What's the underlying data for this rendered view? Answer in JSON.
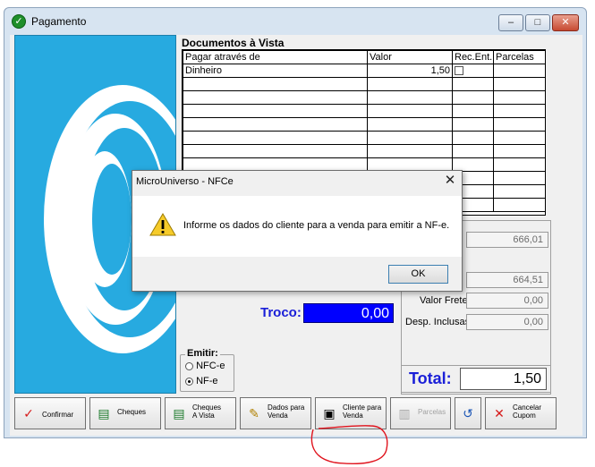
{
  "window": {
    "title": "Pagamento",
    "min_label": "–",
    "max_label": "□",
    "close_label": "✕"
  },
  "documentos": {
    "title": "Documentos à Vista",
    "columns": [
      "Pagar através de",
      "Valor",
      "Rec.Ent.",
      "Parcelas"
    ],
    "rows": [
      {
        "pagar": "Dinheiro",
        "valor": "1,50",
        "rec": "",
        "parcelas": ""
      }
    ],
    "empty_rows": 10
  },
  "totals": {
    "field1_value": "666,01",
    "field2_value": "664,51",
    "frete_label": "Valor Frete:",
    "frete_value": "0,00",
    "desp_label": "Desp. Inclusas:",
    "desp_value": "0,00"
  },
  "troco": {
    "label": "Troco:",
    "value": "0,00"
  },
  "emitir": {
    "label": "Emitir:",
    "options": [
      {
        "label": "NFC-e",
        "selected": false
      },
      {
        "label": "NF-e",
        "selected": true
      }
    ]
  },
  "total": {
    "label": "Total:",
    "value": "1,50"
  },
  "buttons": [
    {
      "id": "confirmar",
      "label": "Confirmar",
      "icon": "checkmark-icon",
      "enabled": true
    },
    {
      "id": "cheques",
      "label": "Cheques",
      "icon": "cheques-icon",
      "enabled": true
    },
    {
      "id": "cheques-vista",
      "label": "Cheques A Vista",
      "icon": "cheques-vista-icon",
      "enabled": true
    },
    {
      "id": "dados-venda",
      "label": "Dados para Venda",
      "icon": "pencil-icon",
      "enabled": true
    },
    {
      "id": "cliente-venda",
      "label": "Cliente para Venda",
      "icon": "client-card-icon",
      "enabled": true
    },
    {
      "id": "parcelas",
      "label": "Parcelas",
      "icon": "parcelas-icon",
      "enabled": false
    },
    {
      "id": "voltar",
      "label": "",
      "icon": "undo-icon",
      "enabled": true
    },
    {
      "id": "cancelar",
      "label": "Cancelar Cupom",
      "icon": "x-icon",
      "enabled": true
    }
  ],
  "dialog": {
    "title": "MicroUniverso - NFCe",
    "message": "Informe os dados do cliente para a venda para emitir a NF-e.",
    "ok_label": "OK",
    "close_label": "✕"
  },
  "colors": {
    "logo_blue": "#27aae0",
    "troco_bg": "#0000ff",
    "label_blue": "#1a1fd8",
    "annotation_red": "#e0141e"
  }
}
